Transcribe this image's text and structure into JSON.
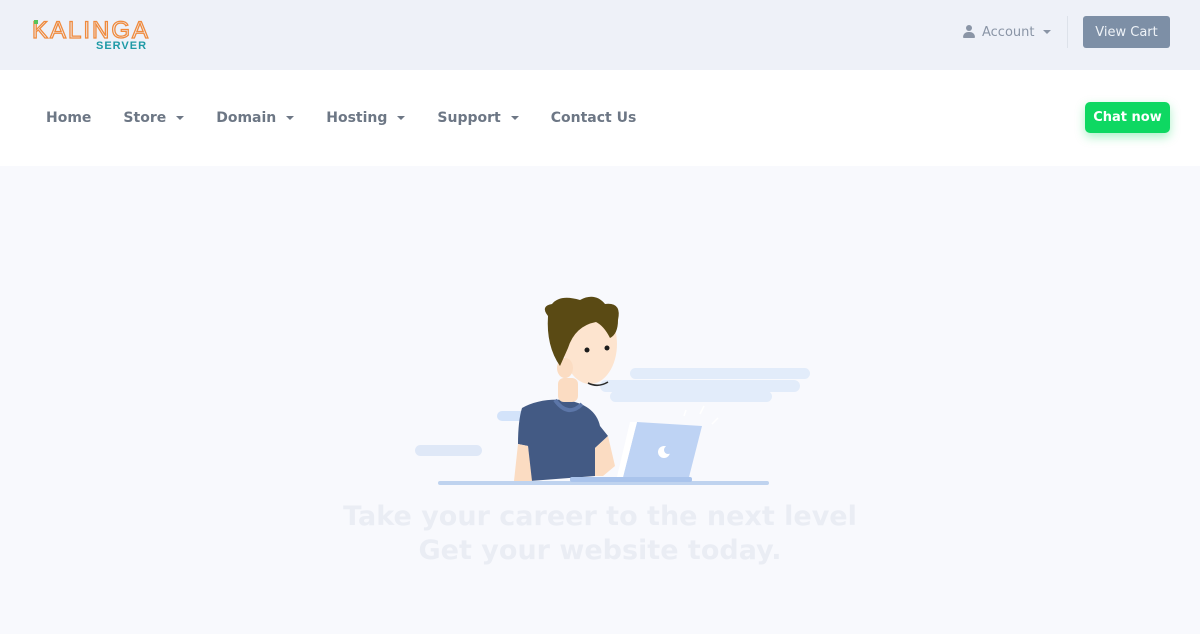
{
  "brand": {
    "name": "KALINGA",
    "subtitle": "SERVER",
    "colors": {
      "primary": "#f08a3c",
      "secondary": "#1e9aa6",
      "accent_dot": "#58c35a"
    }
  },
  "topbar": {
    "account_label": "Account",
    "account_icon": "user-icon",
    "view_cart_label": "View Cart"
  },
  "nav": {
    "items": [
      {
        "label": "Home",
        "dropdown": false
      },
      {
        "label": "Store",
        "dropdown": true
      },
      {
        "label": "Domain",
        "dropdown": true
      },
      {
        "label": "Hosting",
        "dropdown": true
      },
      {
        "label": "Support",
        "dropdown": true
      },
      {
        "label": "Contact Us",
        "dropdown": false
      }
    ],
    "chat_label": "Chat now",
    "chat_color": "#0ed862"
  },
  "hero": {
    "illustration": "person-with-laptop-illustration",
    "line1": "Take your career to the next level",
    "line2": "Get your website today."
  }
}
